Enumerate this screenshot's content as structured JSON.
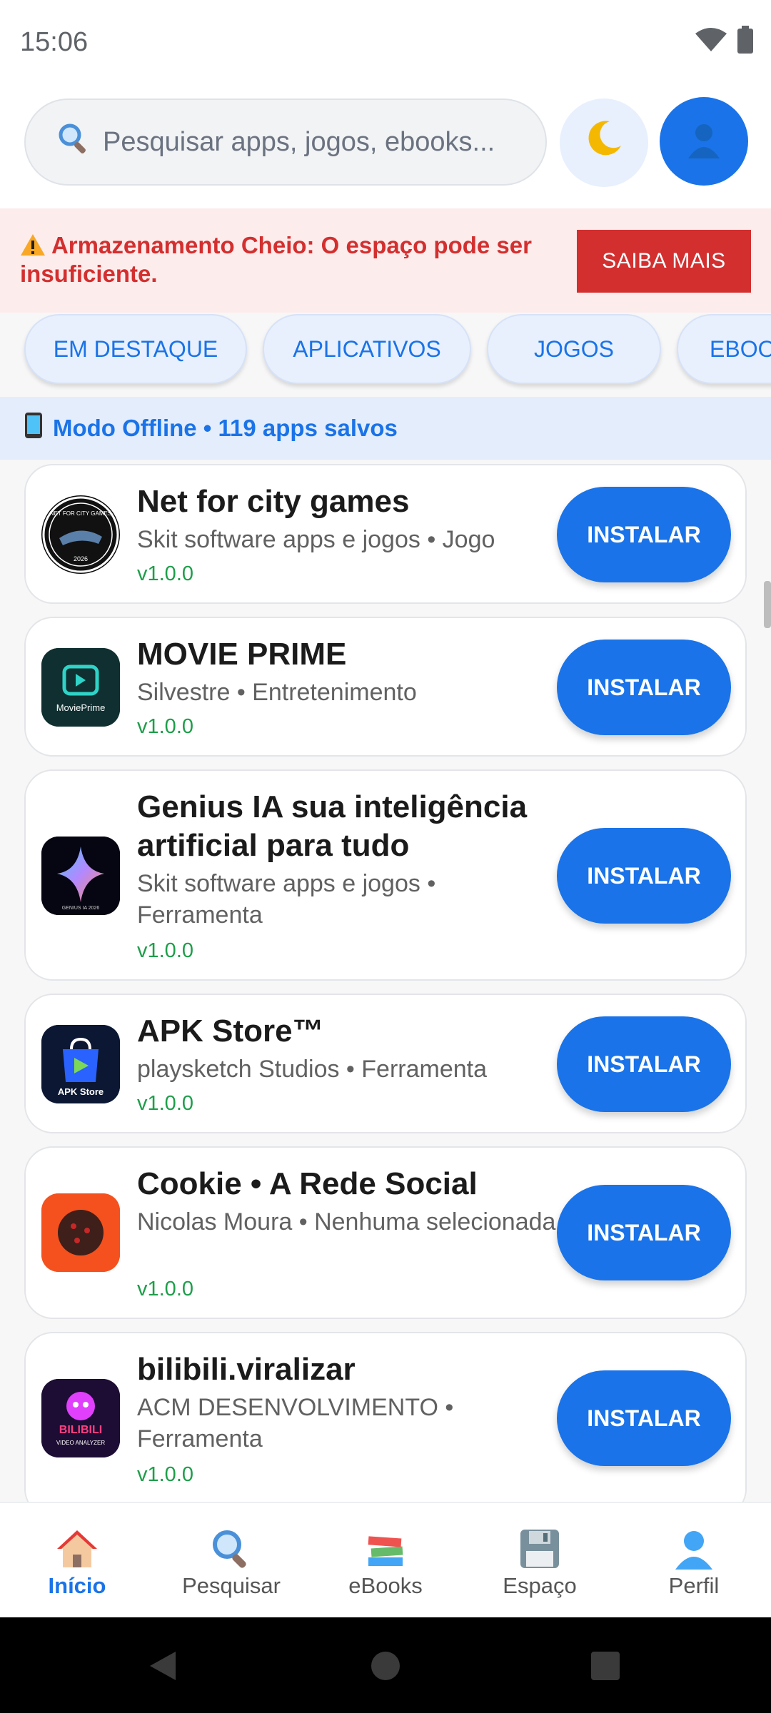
{
  "status_bar": {
    "time": "15:06"
  },
  "search": {
    "placeholder": "Pesquisar apps, jogos, ebooks..."
  },
  "storage_banner": {
    "message": "Armazenamento Cheio: O espaço pode ser insuficiente.",
    "button": "SAIBA MAIS"
  },
  "categories": [
    "EM DESTAQUE",
    "APLICATIVOS",
    "JOGOS",
    "EBOOKS"
  ],
  "offline": {
    "text": "Modo Offline • 119 apps salvos"
  },
  "apps": [
    {
      "name": "Net for city games",
      "meta": "Skit software apps e jogos  • Jogo",
      "version": "v1.0.0",
      "install": "INSTALAR"
    },
    {
      "name": "MOVIE PRIME",
      "meta": "Silvestre • Entretenimento",
      "version": "v1.0.0",
      "install": "INSTALAR"
    },
    {
      "name": "Genius IA sua inteligência artificial para tudo",
      "meta": "Skit software apps e jogos  • Ferramenta",
      "version": "v1.0.0",
      "install": "INSTALAR"
    },
    {
      "name": "APK Store™",
      "meta": "playsketch Studios  • Ferramenta",
      "version": "v1.0.0",
      "install": "INSTALAR"
    },
    {
      "name": "Cookie • A Rede Social",
      "meta": "Nicolas Moura • Nenhuma selecionada",
      "version": "v1.0.0",
      "install": "INSTALAR"
    },
    {
      "name": "bilibili.viralizar",
      "meta": "ACM DESENVOLVIMENTO • Ferramenta",
      "version": "v1.0.0",
      "install": "INSTALAR"
    }
  ],
  "app_icon_text": {
    "net_city": "NET FOR CITY GAMES",
    "net_city_year": "2026",
    "movie_prime": "MoviePrime",
    "genius": "GENIUS IA 2026",
    "apk_store": "APK Store",
    "bilibili": "BILIBILI",
    "bilibili_sub": "VIDEO ANALYZER"
  },
  "bottom_nav": [
    {
      "label": "Início",
      "icon": "home-icon"
    },
    {
      "label": "Pesquisar",
      "icon": "search-icon"
    },
    {
      "label": "eBooks",
      "icon": "books-icon"
    },
    {
      "label": "Espaço",
      "icon": "floppy-disk-icon"
    },
    {
      "label": "Perfil",
      "icon": "person-icon"
    }
  ],
  "colors": {
    "accent": "#1a73e8",
    "danger": "#d32f2f",
    "version_green": "#1e9e4a"
  }
}
